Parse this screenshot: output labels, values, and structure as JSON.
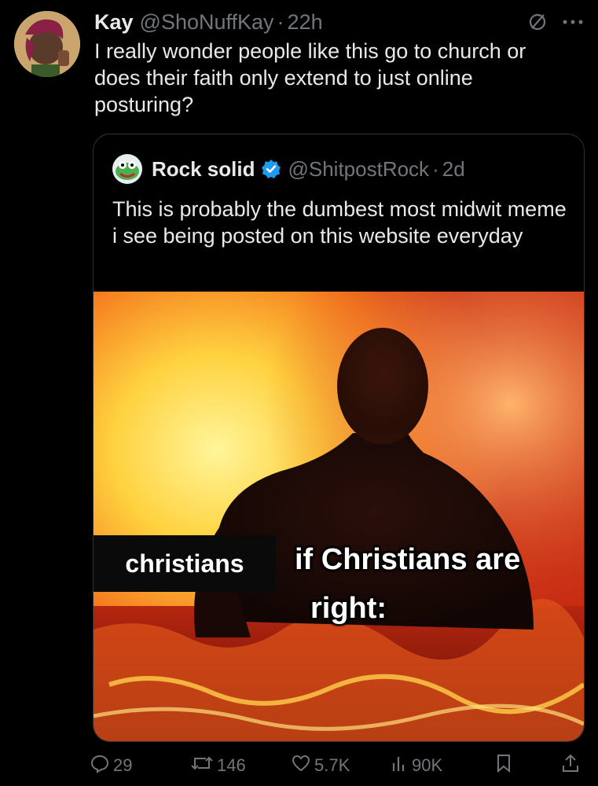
{
  "tweet": {
    "author_name": "Kay",
    "author_handle": "@ShoNuffKay",
    "separator": "·",
    "time": "22h",
    "text": "I really wonder people like this go to church or does their faith only extend to just online posturing?"
  },
  "quote": {
    "author_name": "Rock solid",
    "author_handle": "@ShitpostRock",
    "separator": "·",
    "time": "2d",
    "text": "This is probably the dumbest most midwit meme i see being posted on this website everyday",
    "meme": {
      "left_label": "christians",
      "right_label_line1": "if Christians are",
      "right_label_line2": "right:"
    }
  },
  "actions": {
    "replies": "29",
    "reposts": "146",
    "likes": "5.7K",
    "views": "90K"
  },
  "icons": {
    "mute": "no-entry-icon",
    "more": "more-icon",
    "verified": "verified-badge-icon",
    "reply": "reply-icon",
    "repost": "repost-icon",
    "like": "heart-icon",
    "views": "views-icon",
    "bookmark": "bookmark-icon",
    "share": "share-icon"
  },
  "colors": {
    "background": "#000000",
    "text": "#e7e9ea",
    "muted": "#71767b",
    "verified": "#1d9bf0"
  }
}
